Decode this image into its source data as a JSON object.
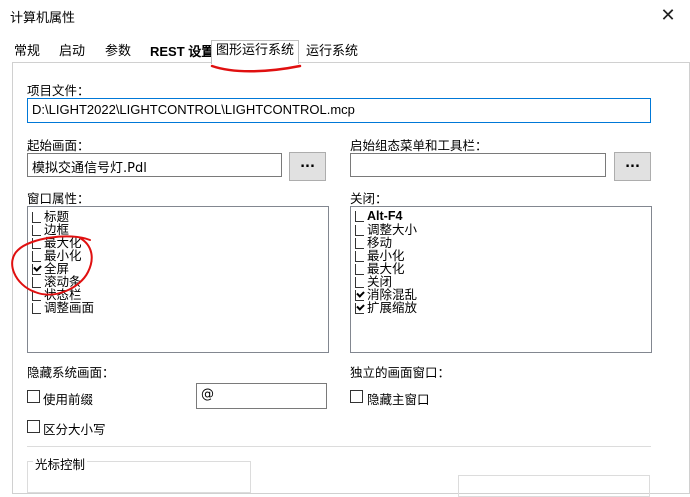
{
  "window": {
    "title": "计算机属性"
  },
  "tabs": [
    {
      "label": "常规"
    },
    {
      "label": "启动"
    },
    {
      "label": "参数"
    },
    {
      "label": "REST 设置"
    },
    {
      "label": "图形运行系统",
      "active": true
    },
    {
      "label": "运行系统"
    }
  ],
  "project_file": {
    "label": "项目文件：",
    "value": "D:\\LIGHT2022\\LIGHTCONTROL\\LIGHTCONTROL.mcp"
  },
  "start_picture": {
    "label": "起始画面：",
    "value": "模拟交通信号灯.Pdl",
    "browse_label": "..."
  },
  "start_menu": {
    "label": "启始组态菜单和工具栏：",
    "value": "",
    "browse_label": "..."
  },
  "window_attributes": {
    "label": "窗口属性：",
    "items": [
      {
        "label": "标题",
        "checked": false
      },
      {
        "label": "边框",
        "checked": false
      },
      {
        "label": "最大化",
        "checked": false
      },
      {
        "label": "最小化",
        "checked": false
      },
      {
        "label": "全屏",
        "checked": true
      },
      {
        "label": "滚动条",
        "checked": false
      },
      {
        "label": "状态栏",
        "checked": false
      },
      {
        "label": "调整画面",
        "checked": false
      }
    ]
  },
  "close_options": {
    "label": "关闭：",
    "items": [
      {
        "label": "Alt-F4",
        "checked": false
      },
      {
        "label": "调整大小",
        "checked": false
      },
      {
        "label": "移动",
        "checked": false
      },
      {
        "label": "最小化",
        "checked": false
      },
      {
        "label": "最大化",
        "checked": false
      },
      {
        "label": "关闭",
        "checked": false
      },
      {
        "label": "消除混乱",
        "checked": true
      },
      {
        "label": "扩展缩放",
        "checked": true
      }
    ]
  },
  "hide_system": {
    "label": "隐藏系统画面：",
    "use_prefix_label": "使用前缀",
    "use_prefix_checked": false,
    "prefix_value": "@",
    "case_sensitive_label": "区分大小写",
    "case_sensitive_checked": false
  },
  "independent_window": {
    "label": "独立的画面窗口：",
    "hide_main_label": "隐藏主窗口",
    "hide_main_checked": false
  },
  "cursor_control": {
    "label": "光标控制"
  },
  "annotation": {
    "color": "#e01010"
  }
}
